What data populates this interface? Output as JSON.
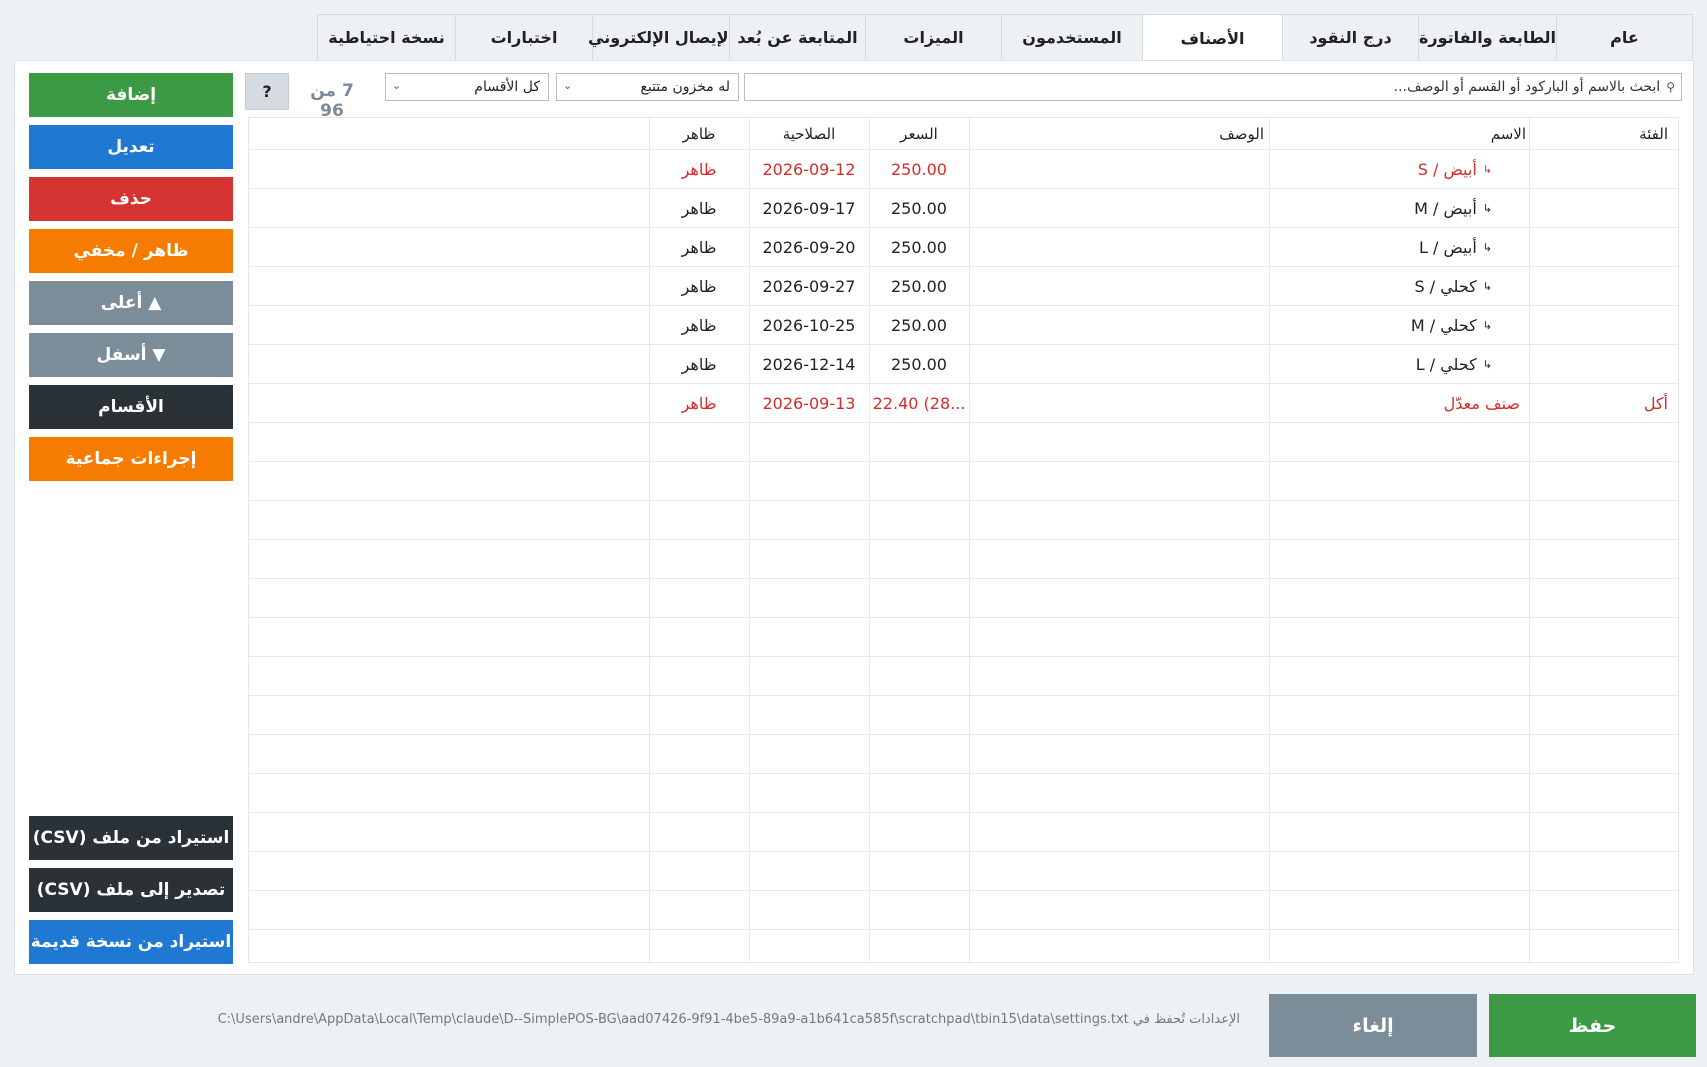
{
  "tabs": [
    {
      "label": "عام"
    },
    {
      "label": "الطابعة والفاتورة"
    },
    {
      "label": "درج النقود"
    },
    {
      "label": "الأصناف"
    },
    {
      "label": "المستخدمون"
    },
    {
      "label": "الميزات"
    },
    {
      "label": "المتابعة عن بُعد"
    },
    {
      "label": "الإيصال الإلكتروني"
    },
    {
      "label": "اختبارات"
    },
    {
      "label": "نسخة احتياطية"
    }
  ],
  "active_tab": "الأصناف",
  "toolbar": {
    "search_placeholder": "ابحث بالاسم أو الباركود أو القسم أو الوصف...",
    "search_icon": "magnifier-icon",
    "stock_filter": "له مخزون متتبع",
    "category_filter": "كل الأقسام",
    "count": "7 من 96",
    "help": "?"
  },
  "table": {
    "headers": {
      "category": "الفئة",
      "name": "الاسم",
      "description": "الوصف",
      "price": "السعر",
      "expiry": "الصلاحية",
      "visible": "ظاهر"
    },
    "rows": [
      {
        "category": "",
        "name": "أبيض / S",
        "prefix": "↳",
        "description": "",
        "price": "250.00",
        "expiry": "2026-09-12",
        "visible": "ظاهر",
        "highlight": true
      },
      {
        "category": "",
        "name": "أبيض / M",
        "prefix": "↳",
        "description": "",
        "price": "250.00",
        "expiry": "2026-09-17",
        "visible": "ظاهر",
        "highlight": false
      },
      {
        "category": "",
        "name": "أبيض / L",
        "prefix": "↳",
        "description": "",
        "price": "250.00",
        "expiry": "2026-09-20",
        "visible": "ظاهر",
        "highlight": false
      },
      {
        "category": "",
        "name": "كحلي / S",
        "prefix": "↳",
        "description": "",
        "price": "250.00",
        "expiry": "2026-09-27",
        "visible": "ظاهر",
        "highlight": false
      },
      {
        "category": "",
        "name": "كحلي / M",
        "prefix": "↳",
        "description": "",
        "price": "250.00",
        "expiry": "2026-10-25",
        "visible": "ظاهر",
        "highlight": false
      },
      {
        "category": "",
        "name": "كحلي / L",
        "prefix": "↳",
        "description": "",
        "price": "250.00",
        "expiry": "2026-12-14",
        "visible": "ظاهر",
        "highlight": false
      },
      {
        "category": "أكل",
        "name": "صنف معدّل",
        "prefix": "",
        "description": "",
        "price": "22.40 (28...",
        "expiry": "2026-09-13",
        "visible": "ظاهر",
        "highlight": true
      }
    ],
    "empty_rows": 14
  },
  "side_buttons": {
    "add": "إضافة",
    "edit": "تعديل",
    "delete": "حذف",
    "toggle_visible": "ظاهر / مخفي",
    "move_up": "▲ أعلى",
    "move_down": "▼ أسفل",
    "categories": "الأقسام",
    "bulk_actions": "إجراءات جماعية",
    "import_csv": "استيراد من ملف (CSV)",
    "export_csv": "تصدير إلى ملف (CSV)",
    "import_legacy": "استيراد من نسخة قديمة"
  },
  "footer": {
    "settings_path": "الإعدادات تُحفظ في C:\\Users\\andre\\AppData\\Local\\Temp\\claude\\D--SimplePOS-BG\\aad07426-9f91-4be5-89a9-a1b641ca585f\\scratchpad\\tbin15\\data\\settings.txt",
    "cancel": "إلغاء",
    "save": "حفظ"
  },
  "colors": {
    "green": "#3b9a43",
    "blue": "#1f78d1",
    "red": "#d63333",
    "orange": "#f57c00",
    "slate": "#7b8d99",
    "dark": "#2a3238",
    "highlight_text": "#d62b2b"
  }
}
